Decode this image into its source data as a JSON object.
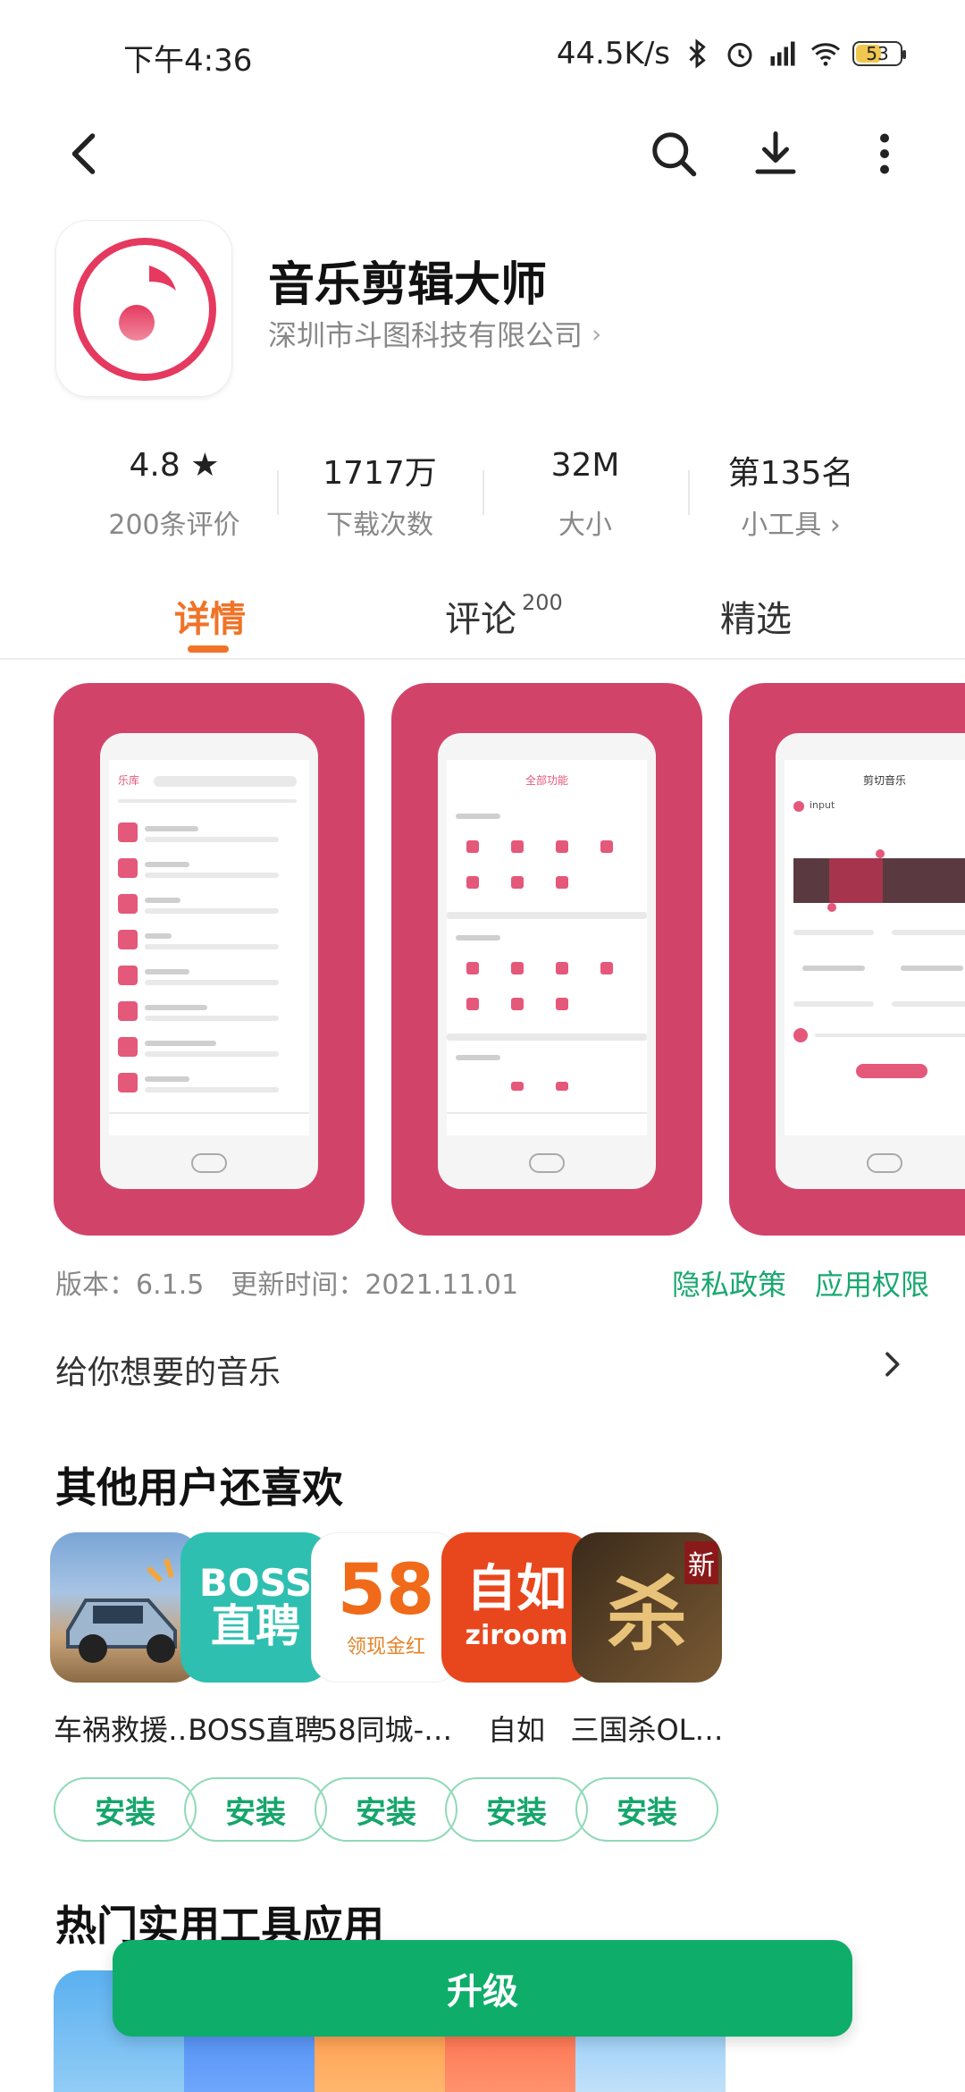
{
  "status_bar": {
    "time": "下午4:36",
    "network_speed": "44.5K/s",
    "battery": "53"
  },
  "app": {
    "name": "音乐剪辑大师",
    "developer": "深圳市斗图科技有限公司",
    "icon": "music-note-icon",
    "brand_color": "#e5395f"
  },
  "stats": [
    {
      "value": "4.8 ★",
      "label": "200条评价"
    },
    {
      "value": "1717万",
      "label": "下载次数"
    },
    {
      "value": "32M",
      "label": "大小"
    },
    {
      "value": "第135名",
      "label": "小工具 ›"
    }
  ],
  "tabs": {
    "details": "详情",
    "reviews": "评论",
    "reviews_count": "200",
    "featured": "精选"
  },
  "meta": {
    "version": "版本：6.1.5",
    "updated": "更新时间：2021.11.01",
    "privacy": "隐私政策",
    "permissions": "应用权限"
  },
  "description": "给你想要的音乐",
  "sections": {
    "also_like": "其他用户还喜欢",
    "popular_tools": "热门实用工具应用"
  },
  "recommended": [
    {
      "name": "车祸救援…",
      "install": "安装"
    },
    {
      "name": "BOSS直聘",
      "install": "安装"
    },
    {
      "name": "58同城-…",
      "install": "安装"
    },
    {
      "name": "自如",
      "install": "安装"
    },
    {
      "name": "三国杀OL…",
      "install": "安装"
    }
  ],
  "rec_icon_text": {
    "boss_top": "BOSS",
    "boss_bottom": "直聘",
    "fifty_eight": "58",
    "fifty_eight_sub": "领现金红",
    "ziru_top": "自如",
    "ziru_bottom": "ziroom",
    "sanguo": "杀",
    "sanguo_badge": "新"
  },
  "upgrade_button": "升级",
  "screenshots": {
    "screen1_title": "乐库",
    "screen2_title": "全部功能",
    "screen3_title": "剪切音乐",
    "screen3_input": "input"
  }
}
